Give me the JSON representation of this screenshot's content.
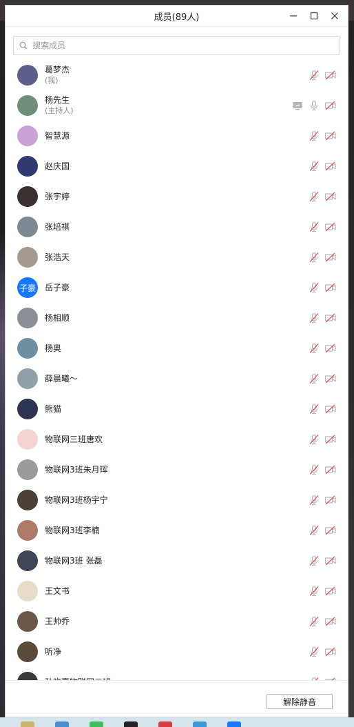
{
  "window": {
    "title": "成员(89人)"
  },
  "search": {
    "placeholder": "搜索成员"
  },
  "members": [
    {
      "name": "葛梦杰",
      "sub": "(我)",
      "avatar_color": "#5b5f8a",
      "avatar_text": "",
      "share": false,
      "mic_on": false,
      "cam_on": false
    },
    {
      "name": "杨先生",
      "sub": "(主持人)",
      "avatar_color": "#6f8f7a",
      "avatar_text": "",
      "share": true,
      "mic_on": true,
      "cam_on": false
    },
    {
      "name": "智慧源",
      "sub": "",
      "avatar_color": "#c9a3d8",
      "avatar_text": "",
      "share": false,
      "mic_on": false,
      "cam_on": false
    },
    {
      "name": "赵庆国",
      "sub": "",
      "avatar_color": "#2f3a72",
      "avatar_text": "",
      "share": false,
      "mic_on": false,
      "cam_on": false
    },
    {
      "name": "张宇婷",
      "sub": "",
      "avatar_color": "#3a3030",
      "avatar_text": "",
      "share": false,
      "mic_on": false,
      "cam_on": false
    },
    {
      "name": "张培祺",
      "sub": "",
      "avatar_color": "#7d8a96",
      "avatar_text": "",
      "share": false,
      "mic_on": false,
      "cam_on": false
    },
    {
      "name": "张浩天",
      "sub": "",
      "avatar_color": "#a59a90",
      "avatar_text": "",
      "share": false,
      "mic_on": false,
      "cam_on": false
    },
    {
      "name": "岳子豪",
      "sub": "",
      "avatar_color": "#1677ff",
      "avatar_text": "子豪",
      "share": false,
      "mic_on": false,
      "cam_on": false
    },
    {
      "name": "杨相顺",
      "sub": "",
      "avatar_color": "#8a8f95",
      "avatar_text": "",
      "share": false,
      "mic_on": false,
      "cam_on": false
    },
    {
      "name": "杨奥",
      "sub": "",
      "avatar_color": "#6d8fa0",
      "avatar_text": "",
      "share": false,
      "mic_on": false,
      "cam_on": false
    },
    {
      "name": "薛晨曦～",
      "sub": "",
      "avatar_color": "#8fa0a8",
      "avatar_text": "",
      "share": false,
      "mic_on": false,
      "cam_on": false
    },
    {
      "name": "熊猫",
      "sub": "",
      "avatar_color": "#2e3550",
      "avatar_text": "",
      "share": false,
      "mic_on": false,
      "cam_on": false
    },
    {
      "name": "物联网三班唐欢",
      "sub": "",
      "avatar_color": "#f4d4d0",
      "avatar_text": "",
      "share": false,
      "mic_on": false,
      "cam_on": false
    },
    {
      "name": "物联网3班朱月珲",
      "sub": "",
      "avatar_color": "#9a9a9a",
      "avatar_text": "",
      "share": false,
      "mic_on": false,
      "cam_on": false
    },
    {
      "name": "物联网3班杨宇宁",
      "sub": "",
      "avatar_color": "#4a4038",
      "avatar_text": "",
      "share": false,
      "mic_on": false,
      "cam_on": false
    },
    {
      "name": "物联网3班李楠",
      "sub": "",
      "avatar_color": "#b07a6a",
      "avatar_text": "",
      "share": false,
      "mic_on": false,
      "cam_on": false
    },
    {
      "name": "物联网3班 张磊",
      "sub": "",
      "avatar_color": "#3f4656",
      "avatar_text": "",
      "share": false,
      "mic_on": false,
      "cam_on": false
    },
    {
      "name": "王文书",
      "sub": "",
      "avatar_color": "#e8dcc8",
      "avatar_text": "",
      "share": false,
      "mic_on": false,
      "cam_on": false
    },
    {
      "name": "王帅乔",
      "sub": "",
      "avatar_color": "#6b5848",
      "avatar_text": "",
      "share": false,
      "mic_on": false,
      "cam_on": false
    },
    {
      "name": "听净",
      "sub": "",
      "avatar_color": "#5a4a3a",
      "avatar_text": "",
      "share": false,
      "mic_on": false,
      "cam_on": false
    },
    {
      "name": "孙晓嘉物联网三班",
      "sub": "",
      "avatar_color": "#3a3a3a",
      "avatar_text": "",
      "share": false,
      "mic_on": false,
      "cam_on": false
    }
  ],
  "footer": {
    "unmute_all_label": "解除静音"
  },
  "colors": {
    "muted_red": "#e04848",
    "icon_gray": "#b8b8b8",
    "accent_blue": "#1677ff"
  }
}
